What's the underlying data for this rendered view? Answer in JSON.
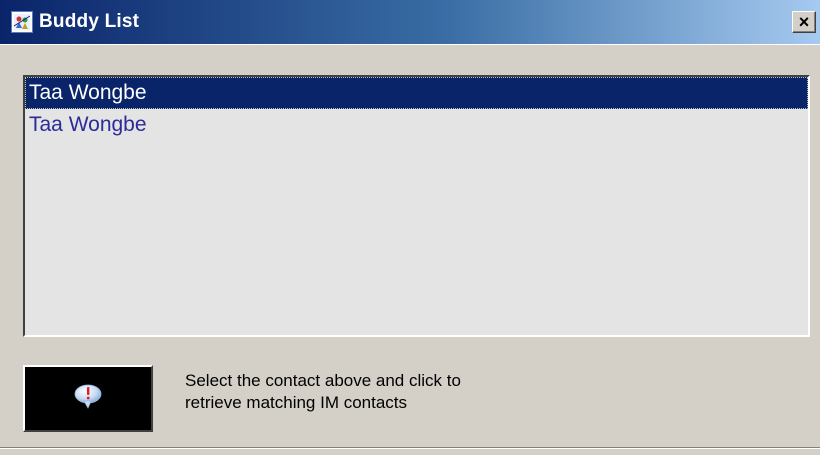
{
  "window": {
    "title": "Buddy List",
    "close_label": "×",
    "icon": "buddy-list-app-icon",
    "titlebar_colors": [
      "#0a246a",
      "#a6caf0"
    ]
  },
  "contacts": {
    "items": [
      {
        "label": "Taa Wongbe",
        "selected": true
      },
      {
        "label": "Taa Wongbe",
        "selected": false
      }
    ],
    "selection_color": "#0a246a",
    "text_color": "#2b2b9a"
  },
  "retrieve": {
    "icon": "speech-bubble-alert-icon",
    "hint_lines": [
      "Select the contact above and click to",
      "retrieve matching IM contacts"
    ]
  }
}
